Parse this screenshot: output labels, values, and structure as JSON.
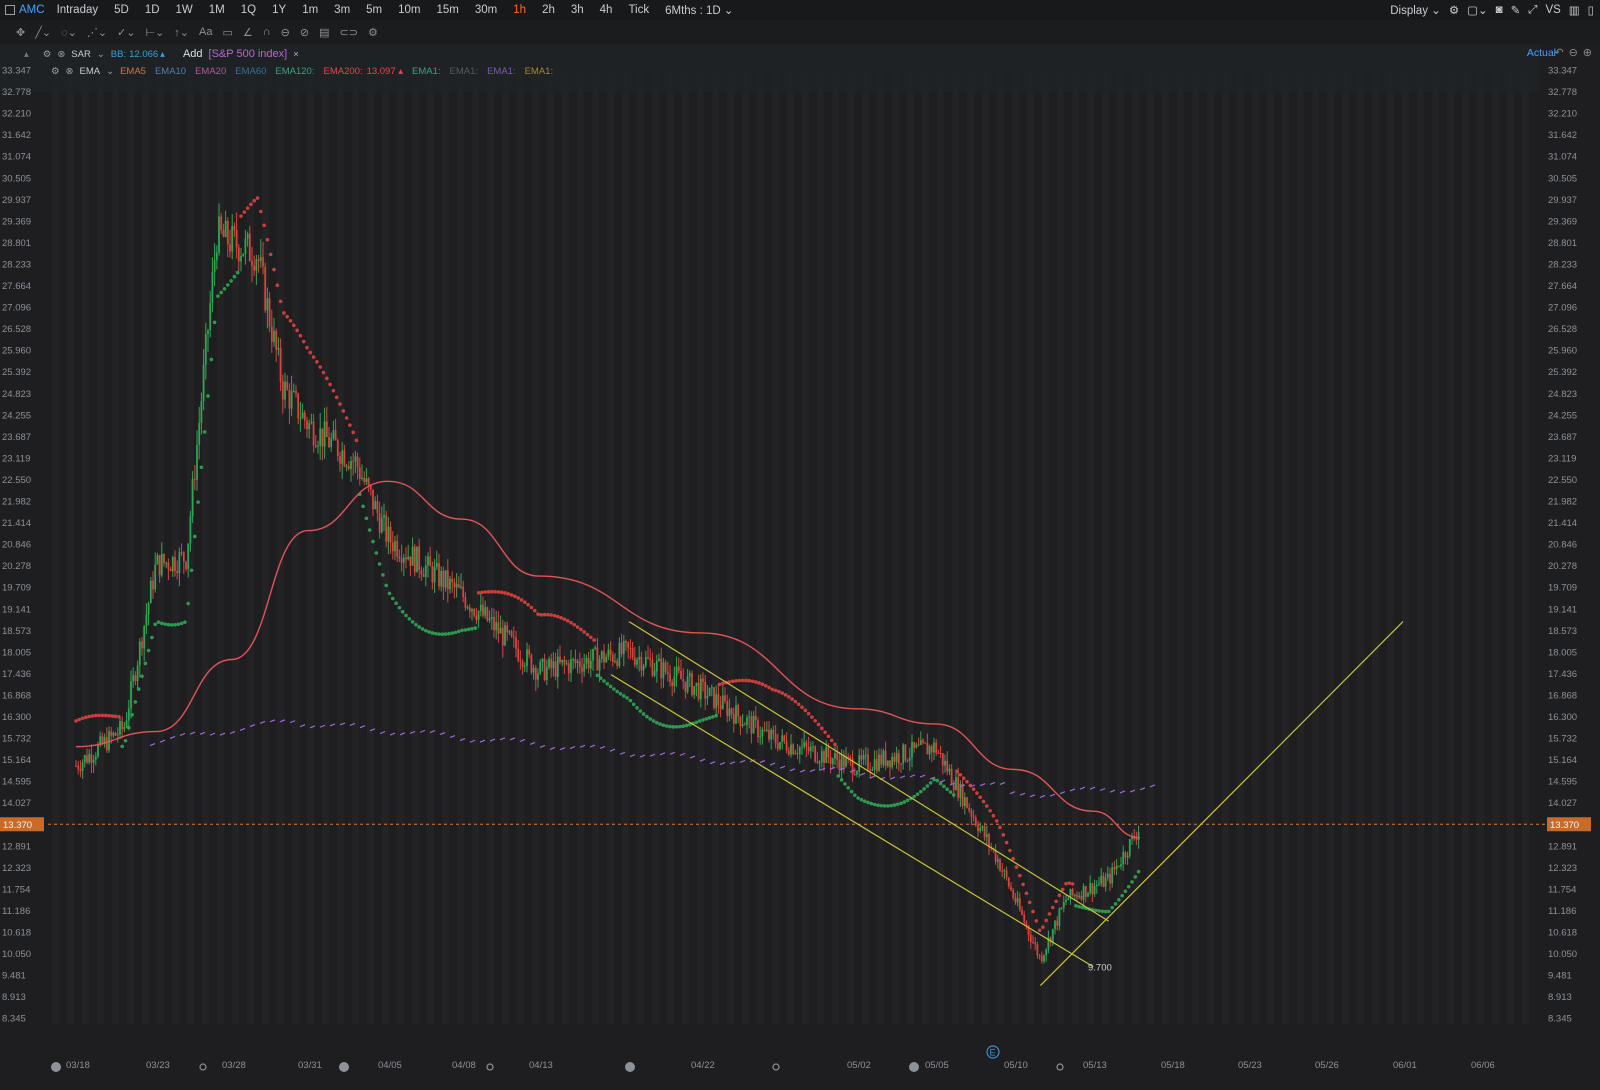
{
  "toolbar": {
    "window_icon": "window-icon",
    "symbol": "AMC",
    "periods": [
      "Intraday",
      "5D",
      "1D",
      "1W",
      "1M",
      "1Q",
      "1Y",
      "1m",
      "3m",
      "5m",
      "10m",
      "15m",
      "30m",
      "1h",
      "2h",
      "3h",
      "4h",
      "Tick"
    ],
    "active_period": "1h",
    "range": "6Mths : 1D",
    "display": "Display",
    "vs": "VS"
  },
  "sar_legend": {
    "name": "SAR",
    "bb_label": "BB:",
    "bb_value": "12.066",
    "add_label": "Add",
    "compare": "[S&P 500 index]",
    "close": "×"
  },
  "ema_legend": {
    "name": "EMA",
    "items": [
      "EMA5",
      "EMA10",
      "EMA20",
      "EMA60",
      "EMA120:",
      "EMA200:",
      "EMA1:",
      "EMA1:",
      "EMA1:",
      "EMA1:"
    ],
    "colors": [
      "#c8764a",
      "#4f7fb3",
      "#b05a9a",
      "#3a6fa0",
      "#3aa37d",
      "#e24a4a",
      "#3aa37d",
      "#555a60",
      "#7a5ab8",
      "#a08a2a"
    ],
    "ema200_value": "13.097"
  },
  "actual_label": "Actual",
  "price_axis": [
    "33.347",
    "32.778",
    "32.210",
    "31.642",
    "31.074",
    "30.505",
    "29.937",
    "29.369",
    "28.801",
    "28.233",
    "27.664",
    "27.096",
    "26.528",
    "25.960",
    "25.392",
    "24.823",
    "24.255",
    "23.687",
    "23.119",
    "22.550",
    "21.982",
    "21.414",
    "20.846",
    "20.278",
    "19.709",
    "19.141",
    "18.573",
    "18.005",
    "17.436",
    "16.868",
    "16.300",
    "15.732",
    "15.164",
    "14.595",
    "14.027",
    "13.370",
    "12.891",
    "12.323",
    "11.754",
    "11.186",
    "10.618",
    "10.050",
    "9.481",
    "8.913",
    "8.345"
  ],
  "last_price": "13.370",
  "low_label": "9.700",
  "date_axis": [
    "03/18",
    "03/23",
    "03/28",
    "03/31",
    "04/05",
    "04/08",
    "04/13",
    "04/22",
    "05/02",
    "05/05",
    "05/10",
    "05/13",
    "05/18",
    "05/23",
    "05/26",
    "06/01",
    "06/06"
  ],
  "event_marker": "E",
  "chart_data": {
    "type": "candlestick",
    "symbol": "AMC",
    "interval": "1h",
    "ylim": [
      8.345,
      33.347
    ],
    "x_start": "03/18",
    "x_end": "06/06",
    "last_price": 13.37,
    "recent_low": 9.7,
    "ema200_last": 13.097,
    "bb_value": 12.066,
    "price_path": [
      {
        "x": "03/18",
        "y": 15.0
      },
      {
        "x": "03/21",
        "y": 16.0
      },
      {
        "x": "03/23",
        "y": 20.3
      },
      {
        "x": "03/25",
        "y": 20.5
      },
      {
        "x": "03/27",
        "y": 29.0
      },
      {
        "x": "03/29",
        "y": 28.5
      },
      {
        "x": "03/30",
        "y": 25.0
      },
      {
        "x": "03/31",
        "y": 24.0
      },
      {
        "x": "04/03",
        "y": 23.0
      },
      {
        "x": "04/05",
        "y": 21.0
      },
      {
        "x": "04/08",
        "y": 19.5
      },
      {
        "x": "04/13",
        "y": 17.5
      },
      {
        "x": "04/18",
        "y": 18.0
      },
      {
        "x": "04/22",
        "y": 17.0
      },
      {
        "x": "04/27",
        "y": 15.7
      },
      {
        "x": "05/02",
        "y": 15.0
      },
      {
        "x": "05/05",
        "y": 15.5
      },
      {
        "x": "05/09",
        "y": 12.5
      },
      {
        "x": "05/11",
        "y": 9.9
      },
      {
        "x": "05/12",
        "y": 11.5
      },
      {
        "x": "05/14",
        "y": 12.0
      },
      {
        "x": "05/16",
        "y": 13.37
      }
    ],
    "ema200_path": [
      {
        "x": "03/18",
        "y": 15.5
      },
      {
        "x": "03/23",
        "y": 15.9
      },
      {
        "x": "03/28",
        "y": 17.8
      },
      {
        "x": "03/31",
        "y": 21.2
      },
      {
        "x": "04/05",
        "y": 22.5
      },
      {
        "x": "04/08",
        "y": 21.5
      },
      {
        "x": "04/13",
        "y": 20.0
      },
      {
        "x": "04/22",
        "y": 18.5
      },
      {
        "x": "05/02",
        "y": 16.5
      },
      {
        "x": "05/05",
        "y": 16.1
      },
      {
        "x": "05/10",
        "y": 14.9
      },
      {
        "x": "05/13",
        "y": 13.8
      },
      {
        "x": "05/16",
        "y": 13.1
      }
    ],
    "trend_lines": [
      {
        "from": {
          "x": "04/18",
          "y": 18.8
        },
        "to": {
          "x": "05/14",
          "y": 10.9
        }
      },
      {
        "from": {
          "x": "04/17",
          "y": 17.4
        },
        "to": {
          "x": "05/13",
          "y": 9.7
        }
      },
      {
        "from": {
          "x": "05/11",
          "y": 9.2
        },
        "to": {
          "x": "06/01",
          "y": 18.8
        }
      }
    ]
  }
}
